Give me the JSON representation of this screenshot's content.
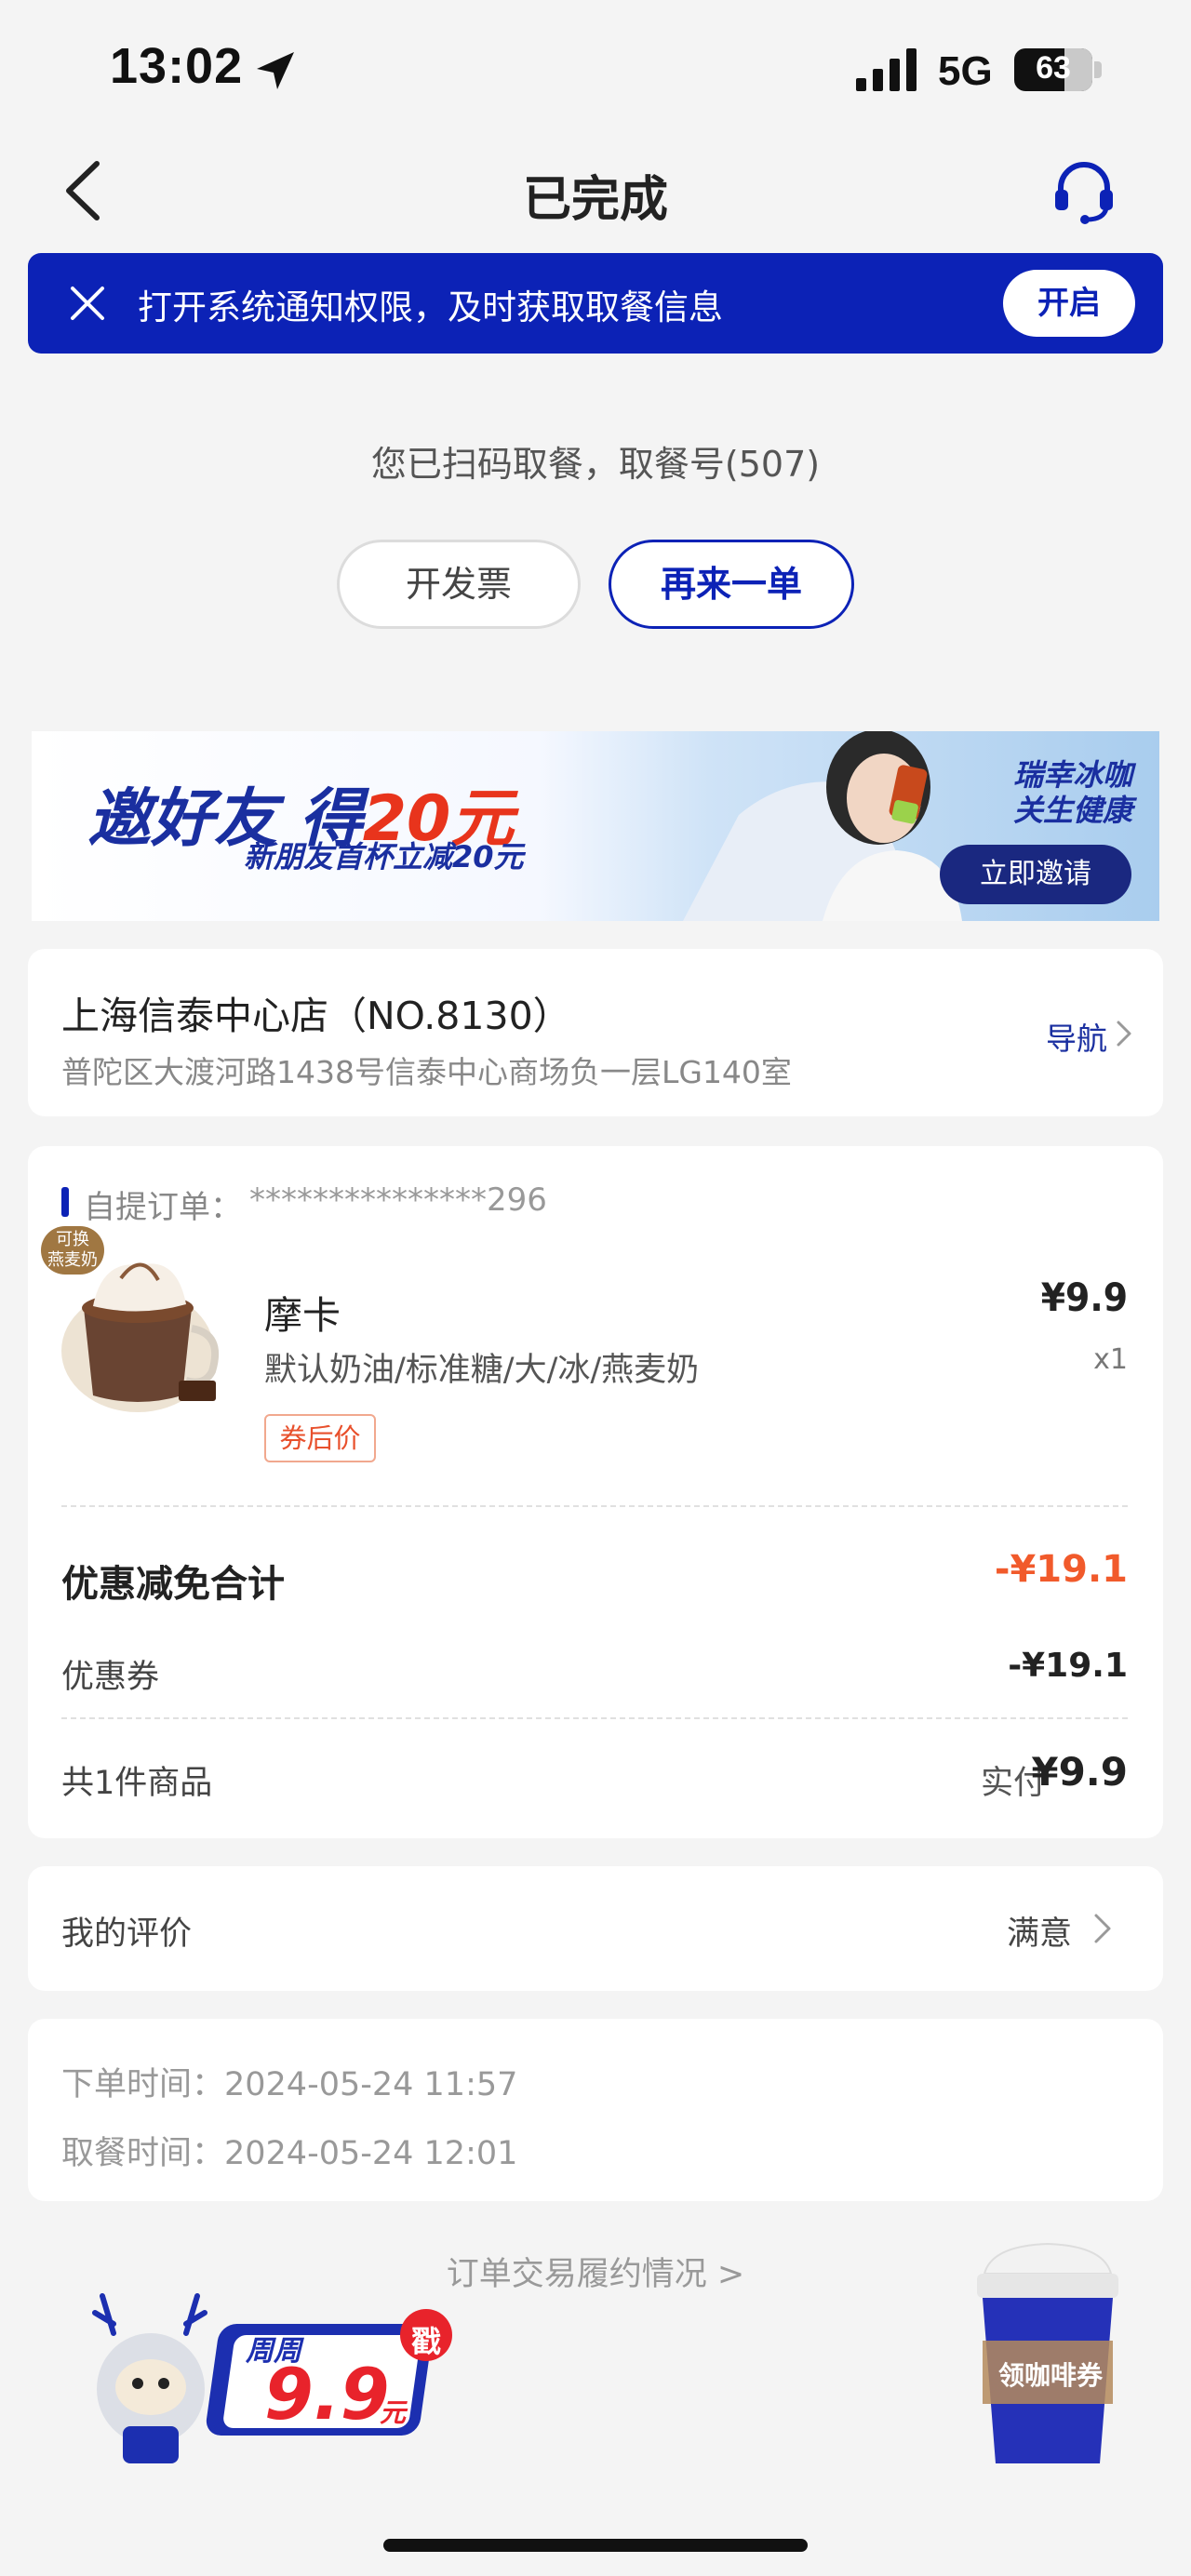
{
  "status_bar": {
    "time": "13:02",
    "network": "5G",
    "battery": "63"
  },
  "nav": {
    "title": "已完成"
  },
  "notification": {
    "text": "打开系统通知权限，及时获取取餐信息",
    "button": "开启"
  },
  "pickup": {
    "message": "您已扫码取餐，取餐号(507)",
    "invoice_button": "开发票",
    "reorder_button": "再来一单"
  },
  "promo": {
    "title_prefix": "邀好友 得",
    "title_amount": "20元",
    "subtitle": "新朋友首杯立减20元",
    "slogan_line1": "瑞幸冰咖",
    "slogan_line2": "关生健康",
    "invite_button": "立即邀请"
  },
  "store": {
    "name": "上海信泰中心店（NO.8130）",
    "address": "普陀区大渡河路1438号信泰中心商场负一层LG140室",
    "nav_label": "导航"
  },
  "order": {
    "label": "自提订单：",
    "number": "***************296",
    "product": {
      "tag_line1": "可换",
      "tag_line2": "燕麦奶",
      "name": "摩卡",
      "spec": "默认奶油/标准糖/大/冰/燕麦奶",
      "coupon_tag": "券后价",
      "price": "¥9.9",
      "qty": "x1"
    },
    "discount_label": "优惠减免合计",
    "discount_value": "-¥19.1",
    "coupon_label": "优惠券",
    "coupon_value": "-¥19.1",
    "items_count": "共1件商品",
    "paid_label": "实付",
    "paid_value": "¥9.9"
  },
  "review": {
    "label": "我的评价",
    "value": "满意"
  },
  "times": {
    "order_time": "下单时间：2024-05-24 11:57",
    "pickup_time": "取餐时间：2024-05-24 12:01"
  },
  "fulfillment_link": "订单交易履约情况 >",
  "bottom": {
    "weekly_label": "周周",
    "weekly_price": "9.9",
    "weekly_unit": "元",
    "stamp": "戳",
    "coffee_coupon": "领咖啡券"
  },
  "colors": {
    "brand": "#0c22b6",
    "discount": "#f15a2b",
    "background": "#f4f4f4"
  },
  "icons": {
    "back": "chevron-left-icon",
    "support": "headset-icon",
    "close": "close-icon",
    "location": "location-arrow-icon"
  }
}
